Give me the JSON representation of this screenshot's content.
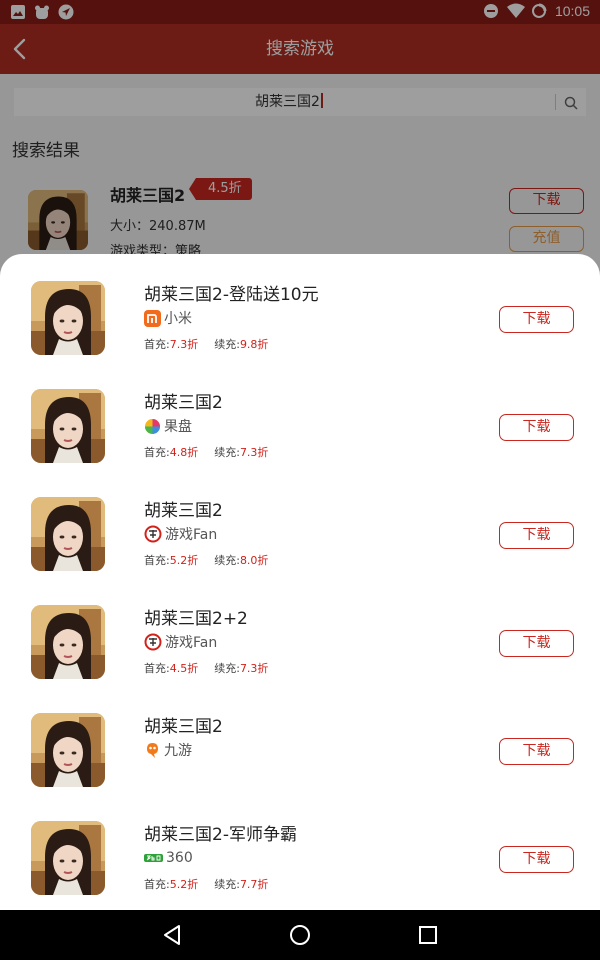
{
  "status_bar": {
    "time": "10:05",
    "left_icons": [
      "image-icon",
      "bear-icon",
      "navigation-icon"
    ],
    "right_icons": [
      "do-not-disturb-icon",
      "wifi-icon",
      "battery-icon"
    ]
  },
  "header": {
    "title": "搜索游戏"
  },
  "search": {
    "query": "胡莱三国2"
  },
  "results_label": "搜索结果",
  "background_result": {
    "name": "胡莱三国2",
    "discount": "4.5折",
    "size": "大小：240.87M",
    "type": "游戏类型：策略",
    "download_label": "下载",
    "recharge_label": "充值"
  },
  "sheet": {
    "items": [
      {
        "title": "胡莱三国2-登陆送10元",
        "source": "小米",
        "source_icon": "xiaomi-icon",
        "first_label": "首充:",
        "first_value": "7.3折",
        "renew_label": "续充:",
        "renew_value": "9.8折",
        "download_label": "下载"
      },
      {
        "title": "胡莱三国2",
        "source": "果盘",
        "source_icon": "guopan-icon",
        "first_label": "首充:",
        "first_value": "4.8折",
        "renew_label": "续充:",
        "renew_value": "7.3折",
        "download_label": "下载"
      },
      {
        "title": "胡莱三国2",
        "source": "游戏Fan",
        "source_icon": "youxifan-icon",
        "first_label": "首充:",
        "first_value": "5.2折",
        "renew_label": "续充:",
        "renew_value": "8.0折",
        "download_label": "下载"
      },
      {
        "title": "胡莱三国2+2",
        "source": "游戏Fan",
        "source_icon": "youxifan-icon",
        "first_label": "首充:",
        "first_value": "4.5折",
        "renew_label": "续充:",
        "renew_value": "7.3折",
        "download_label": "下载"
      },
      {
        "title": "胡莱三国2",
        "source": "九游",
        "source_icon": "jiuyou-icon",
        "download_label": "下载"
      },
      {
        "title": "胡莱三国2-军师争霸",
        "source": "360",
        "source_icon": "360-icon",
        "first_label": "首充:",
        "first_value": "5.2折",
        "renew_label": "续充:",
        "renew_value": "7.7折",
        "download_label": "下载"
      }
    ]
  },
  "colors": {
    "header": "#b02d23",
    "status_bar": "#8a1c15",
    "accent": "#c9271f",
    "recharge": "#e39a4a"
  },
  "nav_icons": [
    "back-nav-icon",
    "home-nav-icon",
    "recents-nav-icon"
  ]
}
